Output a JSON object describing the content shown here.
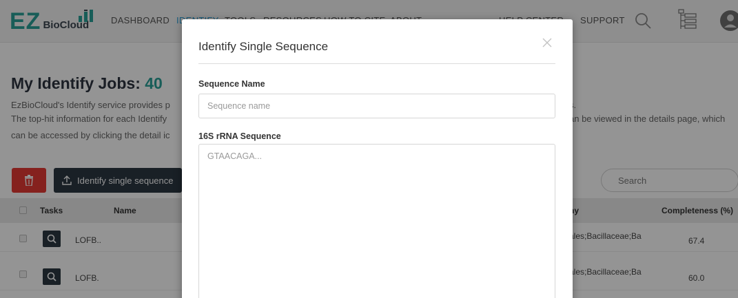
{
  "brand": {
    "logo_main": "EZ",
    "logo_sub": "BioCloud"
  },
  "nav": {
    "dashboard": "DASHBOARD",
    "identify": "IDENTIFY",
    "tools": "TOOLS",
    "resources": "RESOURCES",
    "how_to_cite": "HOW TO CITE",
    "about": "ABOUT",
    "help_center": "HELP CENTER",
    "support": "SUPPORT"
  },
  "page": {
    "title": "My Identify Jobs:",
    "job_count": "40",
    "desc_line1": "EzBioCloud's Identify service provides p",
    "desc_line2": "The top-hit information for each Identify",
    "desc_line3": "can be accessed by clicking the detail ic",
    "desc_right1": "s.",
    "desc_right2": "an be viewed in the details page, which"
  },
  "toolbar": {
    "identify_button": "Identify single sequence",
    "search_placeholder": "Search"
  },
  "table": {
    "headers": {
      "tasks": "Tasks",
      "name": "Name",
      "taxonomy_partial": "ny",
      "completeness": "Completeness (%)"
    },
    "rows": [
      {
        "name": "LOFB..",
        "taxonomy": "ales;Bacillaceae;Ba",
        "completeness": "67.4"
      },
      {
        "name": "LOFB.",
        "taxonomy": "ales;Bacillaceae;Ba",
        "completeness": "60.0"
      }
    ]
  },
  "modal": {
    "title": "Identify Single Sequence",
    "sequence_name_label": "Sequence Name",
    "sequence_name_placeholder": "Sequence name",
    "sequence_label": "16S rRNA Sequence",
    "sequence_placeholder": "GTAACAGA..."
  },
  "colors": {
    "brand_teal": "#2aa198",
    "nav_active": "#2a9fd6",
    "dark_button": "#2b3743",
    "delete_red": "#e53935"
  },
  "icons": [
    "bar-chart-logo-icon",
    "search-icon",
    "tree-list-icon",
    "user-avatar-icon",
    "trash-icon",
    "upload-icon",
    "magnify-detail-icon",
    "close-icon"
  ]
}
